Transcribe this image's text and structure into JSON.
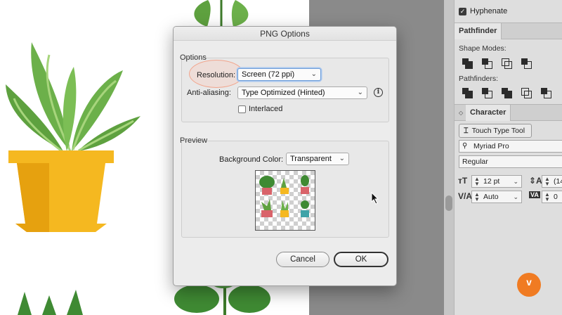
{
  "dialog": {
    "title": "PNG Options",
    "options_group": "Options",
    "resolution_label": "Resolution:",
    "resolution_value": "Screen (72 ppi)",
    "antialias_label": "Anti-aliasing:",
    "antialias_value": "Type Optimized (Hinted)",
    "interlaced_label": "Interlaced",
    "interlaced_checked": false,
    "preview_group": "Preview",
    "bg_label": "Background Color:",
    "bg_value": "Transparent",
    "cancel_label": "Cancel",
    "ok_label": "OK"
  },
  "panel": {
    "hyphenate_label": "Hyphenate",
    "hyphenate_checked": true,
    "pathfinder_tab": "Pathfinder",
    "shape_modes_label": "Shape Modes:",
    "pathfinders_label": "Pathfinders:",
    "character_tab": "Character",
    "touch_type_label": "Touch Type Tool",
    "font_family": "Myriad Pro",
    "font_style": "Regular",
    "font_size": "12 pt",
    "leading": "(14",
    "kerning": "Auto",
    "tracking": "0"
  },
  "icons": [
    "chevron-down-icon",
    "info-icon",
    "touch-type-icon",
    "search-icon",
    "font-size-icon",
    "leading-icon",
    "kerning-icon",
    "tracking-icon",
    "collapse-arrow-icon"
  ],
  "colors": {
    "pot_yellow": "#f5b820",
    "leaf_green": "#6cb04a",
    "brand_orange": "#f07b22"
  }
}
